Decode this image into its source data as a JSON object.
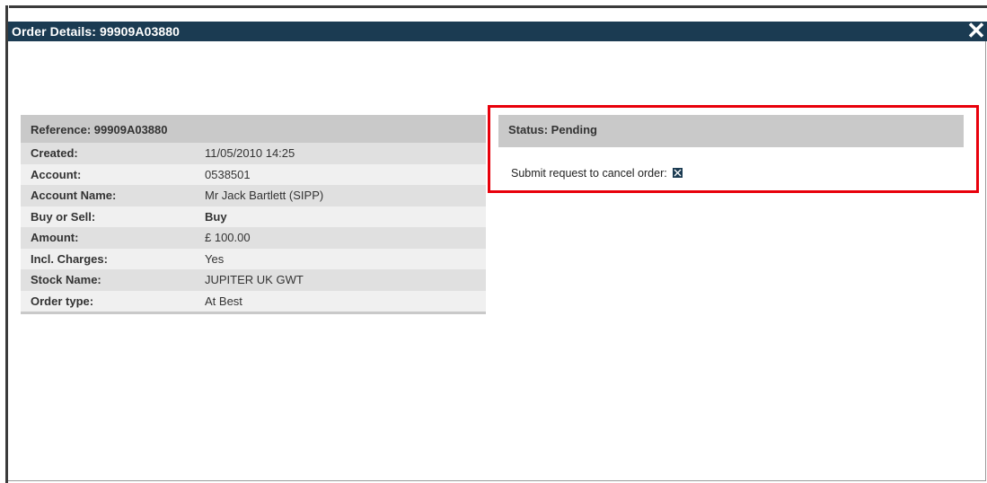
{
  "dialog": {
    "title": "Order Details: 99909A03880",
    "close_icon": "close-icon"
  },
  "details": {
    "header": "Reference: 99909A03880",
    "rows": [
      {
        "label": "Created:",
        "value": "11/05/2010 14:25",
        "bold_value": false
      },
      {
        "label": "Account:",
        "value": "0538501",
        "bold_value": false
      },
      {
        "label": "Account Name:",
        "value": "Mr Jack Bartlett (SIPP)",
        "bold_value": false
      },
      {
        "label": "Buy or Sell:",
        "value": "Buy",
        "bold_value": true
      },
      {
        "label": "Amount:",
        "value": "£ 100.00",
        "bold_value": false
      },
      {
        "label": "Incl. Charges:",
        "value": "Yes",
        "bold_value": false
      },
      {
        "label": "Stock Name:",
        "value": "JUPITER UK GWT",
        "bold_value": false
      },
      {
        "label": "Order type:",
        "value": "At Best",
        "bold_value": false
      }
    ]
  },
  "status": {
    "label": "Status: Pending",
    "cancel_text": "Submit request to cancel order:",
    "cancel_icon": "cancel-x-icon"
  },
  "colors": {
    "titlebar": "#1b3b52",
    "highlight": "#e8000b",
    "header_bg": "#c9c9c9"
  }
}
